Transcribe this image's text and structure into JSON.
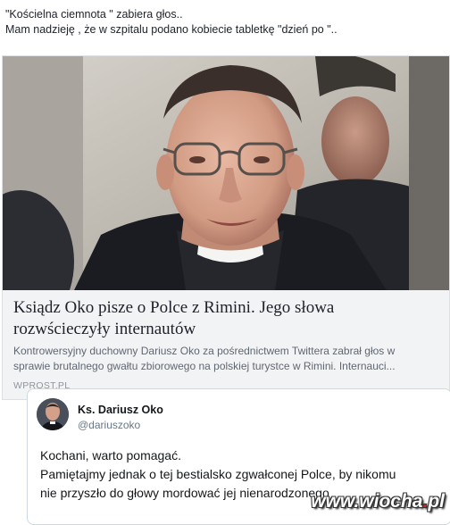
{
  "post": {
    "line1": "\"Kościelna ciemnota \" zabiera głos..",
    "line2": "Mam nadzieję , że w szpitalu podano kobiecie tabletkę \"dzień po \".."
  },
  "link_card": {
    "headline_line1": "Ksiądz Oko pisze o Polce z Rimini. Jego słowa",
    "headline_line2": "rozwścieczyły internautów",
    "description_line1": "Kontrowersyjny duchowny Dariusz Oko za pośrednictwem Twittera zabrał głos w",
    "description_line2": "sprawie brutalnego gwałtu zbiorowego na polskiej turystce w Rimini. Internauci...",
    "source": "WPROST.PL"
  },
  "tweet": {
    "name": "Ks. Dariusz Oko",
    "handle": "@dariuszoko",
    "line1": "Kochani, warto pomagać.",
    "line2": "Pamiętajmy jednak o tej bestialsko zgwałconej Polce, by nikomu",
    "line3": "nie przyszło do głowy mordować jej nienarodzonego"
  },
  "watermark": {
    "prefix": "www.wiocha",
    "dot": ".",
    "suffix": "pl"
  },
  "colors": {
    "card_background": "#f2f3f5",
    "card_border": "#dddfe2",
    "tweet_border": "#cfd9de",
    "watermark_dot": "#d2232a"
  }
}
